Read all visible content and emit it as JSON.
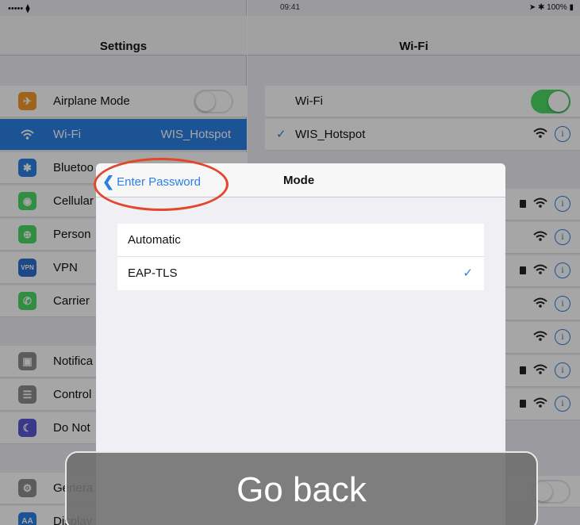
{
  "status_bar": {
    "signal": "••••• ⧫",
    "time": "09:41",
    "battery": "➤ ✱ 100% ▮"
  },
  "settings": {
    "title": "Settings",
    "airplane": {
      "label": "Airplane Mode",
      "icon": "airplane-icon",
      "color": "#f39a2b",
      "on": false
    },
    "wifi": {
      "label": "Wi-Fi",
      "value": "WIS_Hotspot",
      "icon": "wifi-icon",
      "color": "#2c80e4",
      "selected": true
    },
    "bluetooth": {
      "label": "Bluetoo",
      "icon": "bluetooth-icon",
      "color": "#2c80e4"
    },
    "cellular": {
      "label": "Cellular",
      "icon": "cellular-icon",
      "color": "#4cd964"
    },
    "personal": {
      "label": "Person",
      "icon": "hotspot-icon",
      "color": "#4cd964"
    },
    "vpn": {
      "label": "VPN",
      "icon": "vpn-icon",
      "color": "#2c6fd0",
      "icon_text": "VPN"
    },
    "carrier": {
      "label": "Carrier",
      "icon": "phone-icon",
      "color": "#4cd964"
    },
    "notifications": {
      "label": "Notifica",
      "icon": "notifications-icon",
      "color": "#8e8e93"
    },
    "control": {
      "label": "Control",
      "icon": "control-center-icon",
      "color": "#8e8e93"
    },
    "donotdisturb": {
      "label": "Do Not",
      "icon": "moon-icon",
      "color": "#5856d6"
    },
    "general": {
      "label": "Genera",
      "icon": "gear-icon",
      "color": "#8e8e93"
    },
    "display": {
      "label": "Display",
      "icon": "display-icon",
      "color": "#2c80e4",
      "icon_text": "AA"
    }
  },
  "wifi_pane": {
    "title": "Wi-Fi",
    "wifi_label": "Wi-Fi",
    "wifi_on": true,
    "connected_network": "WIS_Hotspot",
    "check": "✓",
    "info": "i"
  },
  "modal": {
    "back_label": "Enter Password",
    "back_chevron": "❮",
    "title": "Mode",
    "options": [
      {
        "label": "Automatic",
        "selected": false
      },
      {
        "label": "EAP-TLS",
        "selected": true
      }
    ],
    "check": "✓"
  },
  "caption": "Go back",
  "colors": {
    "accent": "#2c80e4",
    "annotation": "#e2472d",
    "toggle_on": "#4cd964"
  }
}
